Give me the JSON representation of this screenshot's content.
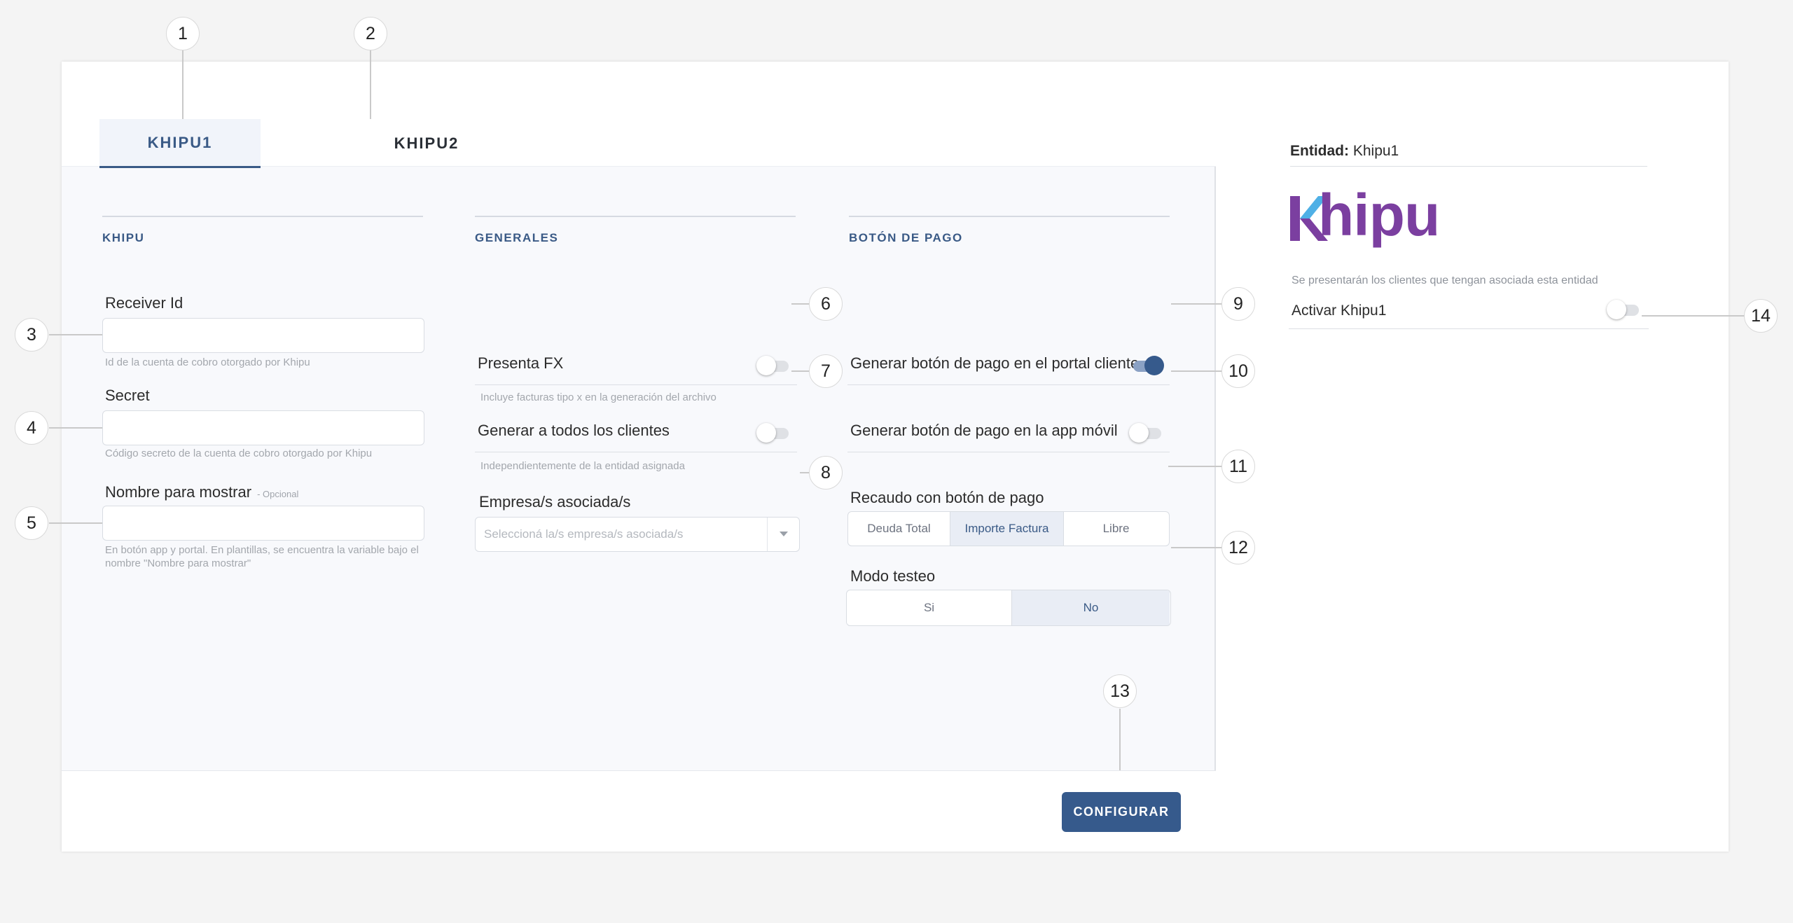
{
  "tabs": [
    {
      "label": "KHIPU1",
      "active": true
    },
    {
      "label": "KHIPU2",
      "active": false
    }
  ],
  "khipu": {
    "title": "KHIPU",
    "receiver_id": {
      "label": "Receiver Id",
      "value": "",
      "help": "Id de la cuenta de cobro otorgado por Khipu"
    },
    "secret": {
      "label": "Secret",
      "value": "",
      "help": "Código secreto de la cuenta de cobro otorgado por Khipu"
    },
    "display_name": {
      "label": "Nombre para mostrar",
      "optional": "- Opcional",
      "value": "",
      "help_line1": "En botón app y portal. En plantillas, se encuentra la variable bajo el",
      "help_line2": "nombre \"Nombre para mostrar\""
    }
  },
  "generales": {
    "title": "GENERALES",
    "presenta_fx": {
      "label": "Presenta FX",
      "help": "Incluye facturas tipo x en la generación del archivo",
      "on": false
    },
    "todos_clientes": {
      "label": "Generar a todos los clientes",
      "help": "Independientemente de la entidad asignada",
      "on": false
    },
    "empresas": {
      "label": "Empresa/s asociada/s",
      "placeholder": "Seleccioná la/s empresa/s asociada/s"
    }
  },
  "boton_pago": {
    "title": "BOTÓN DE PAGO",
    "portal_cliente": {
      "label": "Generar botón de pago en el portal cliente",
      "on": true
    },
    "app_movil": {
      "label": "Generar botón de pago en la app móvil",
      "on": false
    },
    "recaudo": {
      "label": "Recaudo con botón de pago",
      "options": [
        "Deuda Total",
        "Importe Factura",
        "Libre"
      ],
      "selected": "Importe Factura"
    },
    "modo_testeo": {
      "label": "Modo testeo",
      "options": [
        "Si",
        "No"
      ],
      "selected": "No"
    }
  },
  "footer": {
    "configure_label": "CONFIGURAR"
  },
  "right_panel": {
    "entity_label": "Entidad:",
    "entity_value": "Khipu1",
    "logo_text": "hipu",
    "help": "Se presentarán los clientes que tengan asociada esta entidad",
    "activate": {
      "label": "Activar Khipu1",
      "on": false
    }
  },
  "callouts": [
    "1",
    "2",
    "3",
    "4",
    "5",
    "6",
    "7",
    "8",
    "9",
    "10",
    "11",
    "12",
    "13",
    "14"
  ],
  "colors": {
    "accent": "#365a8c",
    "logo_purple": "#7b3fa0",
    "logo_blue": "#4fb0e6"
  }
}
